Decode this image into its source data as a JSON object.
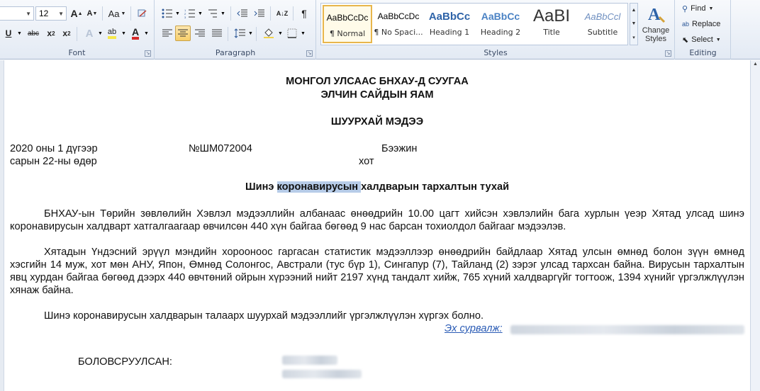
{
  "ribbon": {
    "font": {
      "label": "Font",
      "size_value": "12",
      "grow_label": "A",
      "shrink_label": "A",
      "case_label": "Aa",
      "bold_label": "U",
      "strike_label": "abc",
      "sub_label": "x",
      "sup_label": "x",
      "font_color_label": "A"
    },
    "paragraph": {
      "label": "Paragraph"
    },
    "styles": {
      "label": "Styles",
      "items": [
        {
          "sample": "AaBbCcDc",
          "name": "¶ Normal"
        },
        {
          "sample": "AaBbCcDc",
          "name": "¶ No Spaci..."
        },
        {
          "sample": "AaBbCc",
          "name": "Heading 1"
        },
        {
          "sample": "AaBbCc",
          "name": "Heading 2"
        },
        {
          "sample": "AaBI",
          "name": "Title"
        },
        {
          "sample": "AaBbCcl",
          "name": "Subtitle"
        }
      ],
      "change_styles": "Change Styles"
    },
    "editing": {
      "label": "Editing",
      "find": "Find",
      "replace": "Replace",
      "select": "Select"
    }
  },
  "document": {
    "header_line1": "МОНГОЛ УЛСААС БНХАУ-Д СУУГАА",
    "header_line2": "ЭЛЧИН САЙДЫН ЯАМ",
    "doc_type": "ШУУРХАЙ МЭДЭЭ",
    "date_line1": "2020 оны 1 дүгээр",
    "date_line2": "сарын 22-ны өдөр",
    "number": "№ШМ072004",
    "city_line1": "Бээжин",
    "city_line2": "хот",
    "title_before": "Шинэ ",
    "title_highlight": "коронавирусын ",
    "title_after": "халдварын тархалтын тухай",
    "para1": "БНХАУ-ын Төрийн зөвлөлийн Хэвлэл мэдээллийн албанаас өнөөдрийн 10.00 цагт хийсэн хэвлэлийн бага хурлын үеэр Хятад улсад шинэ коронавирусын халдварт хатгалгаагаар өвчилсөн 440 хүн байгаа бөгөөд 9 нас барсан тохиолдол байгааг мэдээлэв.",
    "para2": "Хятадын Үндэсний эрүүл мэндийн хорооноос гаргасан статистик мэдээллээр өнөөдрийн байдлаар Хятад улсын өмнөд болон зүүн өмнөд хэсгийн 14 муж, хот мөн АНУ, Япон, Өмнөд Солонгос, Австрали (тус бүр 1), Сингапур (7), Тайланд (2) зэрэг улсад тархсан байна. Вирусын тархалтын явц хурдан байгаа бөгөөд дээрх 440 өвчтөний ойрын хүрээний нийт 2197 хүнд тандалт хийж, 765 хүний халдваргүйг тогтоож, 1394 хүнийг үргэлжлүүлэн хянаж байна.",
    "para3": "Шинэ коронавирусын халдварын талаарх шуурхай мэдээллийг үргэлжлүүлэн хүргэх болно.",
    "source_label": "Эх сурвалж:",
    "prepared_label": "БОЛОВСРУУЛСАН:"
  }
}
